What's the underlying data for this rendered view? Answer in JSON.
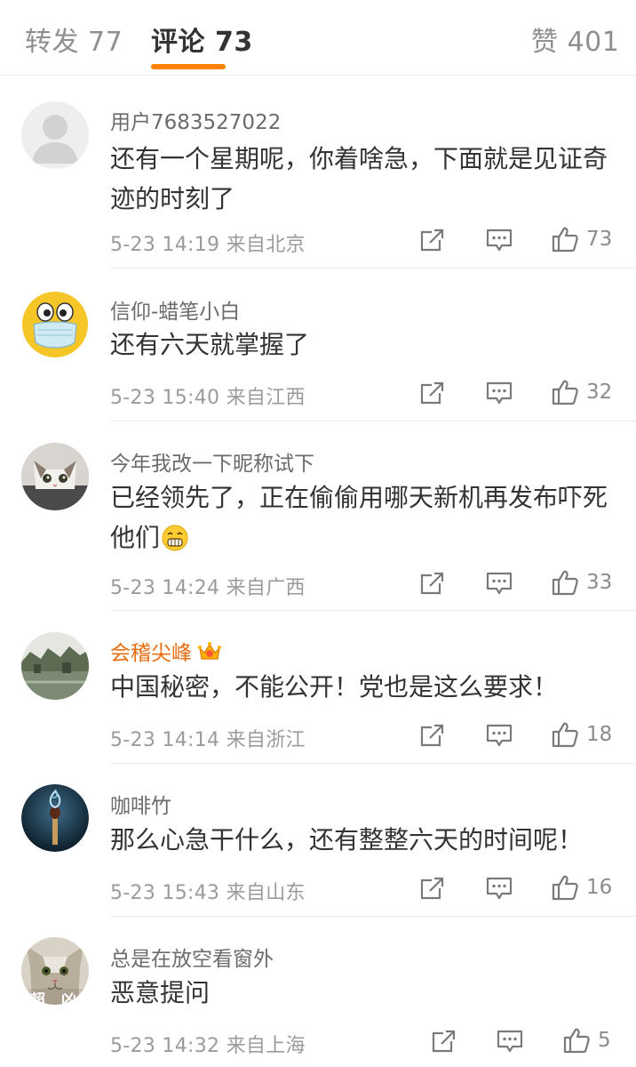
{
  "tabs": {
    "repost": {
      "label": "转发",
      "count": "77"
    },
    "comments": {
      "label": "评论",
      "count": "73"
    },
    "likes": {
      "label": "赞",
      "count": "401"
    }
  },
  "colors": {
    "accent": "#ff8200",
    "vip_name": "#e86b0e"
  },
  "comments": [
    {
      "user": "用户7683527022",
      "text": "还有一个星期呢，你着啥急，下面就是见证奇迹的时刻了",
      "time": "5-23 14:19",
      "location": "来自北京",
      "likes": "73",
      "avatar": "default-avatar-icon"
    },
    {
      "user": "信仰-蜡笔小白",
      "text": "还有六天就掌握了",
      "time": "5-23 15:40",
      "location": "来自江西",
      "likes": "32",
      "avatar": "mask-face-avatar"
    },
    {
      "user": "今年我改一下昵称试下",
      "text": "已经领先了，正在偷偷用哪天新机再发布吓死他们",
      "time": "5-23 14:24",
      "location": "来自广西",
      "likes": "33",
      "avatar": "cat-avatar",
      "emoji": "grimace-emoji-icon"
    },
    {
      "user": "会稽尖峰",
      "text": "中国秘密，不能公开！党也是这么要求！",
      "time": "5-23 14:14",
      "location": "来自浙江",
      "likes": "18",
      "avatar": "landscape-avatar",
      "badge": "crown-badge-icon"
    },
    {
      "user": "咖啡竹",
      "text": "那么心急干什么，还有整整六天的时间呢！",
      "time": "5-23 15:43",
      "location": "来自山东",
      "likes": "16",
      "avatar": "matchstick-avatar"
    },
    {
      "user": "总是在放空看窗外",
      "text": "恶意提问",
      "time": "5-23 14:32",
      "location": "来自上海",
      "likes": "5",
      "avatar": "cat-photo-avatar",
      "avatar_text": "超 凶"
    }
  ],
  "icons": {
    "share": "share-icon",
    "reply": "reply-icon",
    "like": "thumbs-up-icon"
  }
}
